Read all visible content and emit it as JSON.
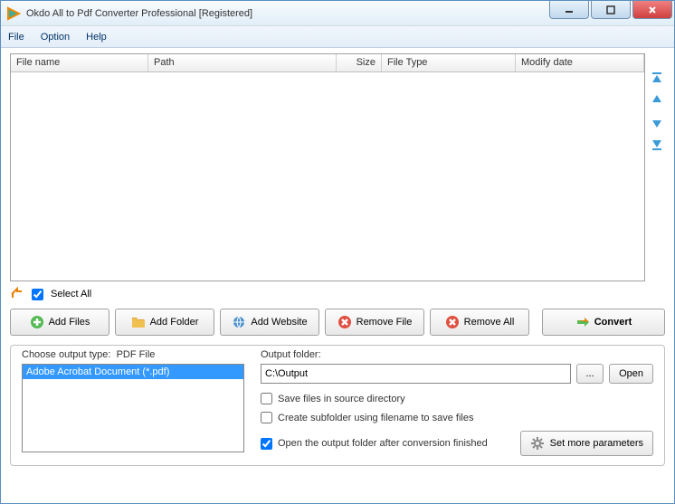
{
  "window": {
    "title": "Okdo All to Pdf Converter Professional [Registered]"
  },
  "menu": {
    "file": "File",
    "option": "Option",
    "help": "Help"
  },
  "columns": {
    "name": "File name",
    "path": "Path",
    "size": "Size",
    "type": "File Type",
    "date": "Modify date"
  },
  "selectAll": "Select All",
  "buttons": {
    "addFiles": "Add Files",
    "addFolder": "Add Folder",
    "addWebsite": "Add Website",
    "removeFile": "Remove File",
    "removeAll": "Remove All",
    "convert": "Convert"
  },
  "output": {
    "chooseTypeLabel": "Choose output type:",
    "typeValue": "PDF File",
    "typeItem": "Adobe Acrobat Document (*.pdf)",
    "folderLabel": "Output folder:",
    "folderPath": "C:\\Output",
    "browse": "...",
    "open": "Open",
    "saveInSource": "Save files in source directory",
    "createSubfolder": "Create subfolder using filename to save files",
    "openAfter": "Open the output folder after conversion finished",
    "moreParams": "Set more parameters"
  },
  "checks": {
    "selectAll": true,
    "saveInSource": false,
    "createSubfolder": false,
    "openAfter": true
  }
}
